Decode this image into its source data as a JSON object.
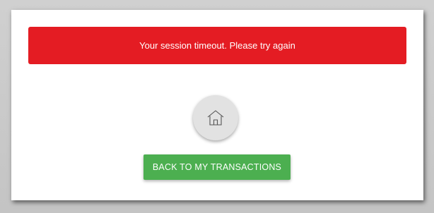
{
  "alert": {
    "message": "Your session timeout. Please try again",
    "color": "#e41c23"
  },
  "home_button": {
    "icon": "home-icon"
  },
  "back_button": {
    "label": "BACK TO MY TRANSACTIONS",
    "color": "#4caf50"
  }
}
